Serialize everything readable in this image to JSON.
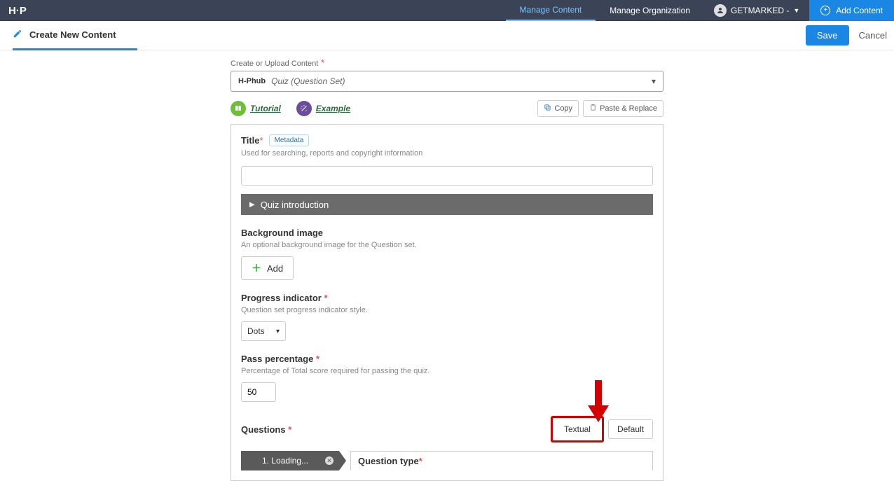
{
  "topbar": {
    "logo": "H·P",
    "manage_content": "Manage Content",
    "manage_org": "Manage Organization",
    "user_name": "GETMARKED -",
    "add_content": "Add Content"
  },
  "subbar": {
    "create_tab": "Create New Content",
    "save": "Save",
    "cancel": "Cancel"
  },
  "form": {
    "create_upload_label": "Create or Upload Content",
    "hub_brand": "H-Phub",
    "hub_type": "Quiz (Question Set)",
    "tutorial": "Tutorial",
    "example": "Example",
    "copy": "Copy",
    "paste_replace": "Paste & Replace",
    "title_label": "Title",
    "metadata": "Metadata",
    "title_help": "Used for searching, reports and copyright information",
    "title_value": "",
    "quiz_intro": "Quiz introduction",
    "bg_image_label": "Background image",
    "bg_image_help": "An optional background image for the Question set.",
    "add_btn": "Add",
    "progress_label": "Progress indicator",
    "progress_help": "Question set progress indicator style.",
    "progress_value": "Dots",
    "pass_label": "Pass percentage",
    "pass_help": "Percentage of Total score required for passing the quiz.",
    "pass_value": "50",
    "questions_label": "Questions",
    "tab_textual": "Textual",
    "tab_default": "Default",
    "loading_tab": "1. Loading...",
    "qtype_label": "Question type"
  }
}
